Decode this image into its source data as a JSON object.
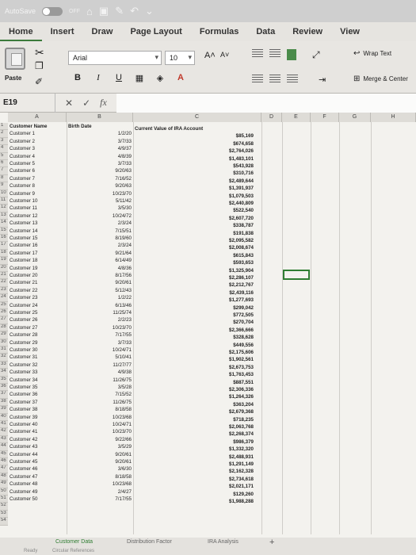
{
  "titlebar": {
    "autosave": "AutoSave",
    "toggle": "OFF"
  },
  "tabs": [
    "Home",
    "Insert",
    "Draw",
    "Page Layout",
    "Formulas",
    "Data",
    "Review",
    "View"
  ],
  "ribbon": {
    "paste_label": "Paste",
    "font_name": "Arial",
    "font_size": "10",
    "grow_font": "A˄",
    "shrink_font": "A˅",
    "bold": "B",
    "italic": "I",
    "underline": "U",
    "wrap_text": "Wrap Text",
    "merge_center": "Merge & Center"
  },
  "formula_bar": {
    "name_box": "E19",
    "fx": "fx"
  },
  "columns": [
    "A",
    "B",
    "C",
    "D",
    "E",
    "F",
    "G",
    "H"
  ],
  "headers": {
    "name": "Customer Name",
    "birth": "Birth Date",
    "value": "Current Value of IRA Account"
  },
  "rows": [
    [
      "Customer 1",
      "1/2/20",
      "$85,169"
    ],
    [
      "Customer 2",
      "3/7/33",
      "$674,658"
    ],
    [
      "Customer 3",
      "4/9/37",
      "$2,764,026"
    ],
    [
      "Customer 4",
      "4/8/39",
      "$1,483,101"
    ],
    [
      "Customer 5",
      "3/7/33",
      "$543,928"
    ],
    [
      "Customer 6",
      "9/20/63",
      "$310,716"
    ],
    [
      "Customer 7",
      "7/16/52",
      "$2,489,644"
    ],
    [
      "Customer 8",
      "9/20/63",
      "$1,391,937"
    ],
    [
      "Customer 9",
      "10/23/70",
      "$1,079,503"
    ],
    [
      "Customer 10",
      "5/11/42",
      "$2,440,809"
    ],
    [
      "Customer 11",
      "3/5/30",
      "$522,540"
    ],
    [
      "Customer 12",
      "10/24/72",
      "$2,607,720"
    ],
    [
      "Customer 13",
      "2/3/24",
      "$338,787"
    ],
    [
      "Customer 14",
      "7/15/51",
      "$191,838"
    ],
    [
      "Customer 15",
      "8/19/60",
      "$2,095,582"
    ],
    [
      "Customer 16",
      "2/3/24",
      "$2,008,674"
    ],
    [
      "Customer 17",
      "9/21/64",
      "$615,843"
    ],
    [
      "Customer 18",
      "6/14/49",
      "$593,653"
    ],
    [
      "Customer 19",
      "4/8/36",
      "$1,325,904"
    ],
    [
      "Customer 20",
      "8/17/56",
      "$2,286,107"
    ],
    [
      "Customer 21",
      "9/20/61",
      "$2,212,767"
    ],
    [
      "Customer 22",
      "5/12/43",
      "$2,439,116"
    ],
    [
      "Customer 23",
      "1/2/22",
      "$1,277,693"
    ],
    [
      "Customer 24",
      "6/13/46",
      "$299,042"
    ],
    [
      "Customer 25",
      "11/25/74",
      "$772,505"
    ],
    [
      "Customer 26",
      "2/2/23",
      "$270,704"
    ],
    [
      "Customer 27",
      "10/23/70",
      "$2,366,666"
    ],
    [
      "Customer 28",
      "7/17/55",
      "$328,628"
    ],
    [
      "Customer 29",
      "3/7/33",
      "$449,556"
    ],
    [
      "Customer 30",
      "10/24/71",
      "$2,175,606"
    ],
    [
      "Customer 31",
      "5/10/41",
      "$1,902,561"
    ],
    [
      "Customer 32",
      "11/27/77",
      "$2,673,753"
    ],
    [
      "Customer 33",
      "4/9/38",
      "$1,763,453"
    ],
    [
      "Customer 34",
      "11/26/75",
      "$887,551"
    ],
    [
      "Customer 35",
      "3/5/28",
      "$2,306,336"
    ],
    [
      "Customer 36",
      "7/15/52",
      "$1,264,326"
    ],
    [
      "Customer 37",
      "11/26/75",
      "$363,204"
    ],
    [
      "Customer 38",
      "8/18/58",
      "$2,679,368"
    ],
    [
      "Customer 39",
      "10/23/68",
      "$718,235"
    ],
    [
      "Customer 40",
      "10/24/71",
      "$2,063,768"
    ],
    [
      "Customer 41",
      "10/23/70",
      "$2,268,374"
    ],
    [
      "Customer 42",
      "9/22/66",
      "$986,379"
    ],
    [
      "Customer 43",
      "3/5/29",
      "$1,332,320"
    ],
    [
      "Customer 44",
      "9/20/61",
      "$2,488,931"
    ],
    [
      "Customer 45",
      "9/20/61",
      "$1,291,149"
    ],
    [
      "Customer 46",
      "3/6/30",
      "$2,162,328"
    ],
    [
      "Customer 47",
      "8/18/58",
      "$2,734,618"
    ],
    [
      "Customer 48",
      "10/23/68",
      "$2,021,171"
    ],
    [
      "Customer 49",
      "2/4/27",
      "$129,260"
    ],
    [
      "Customer 50",
      "7/17/55",
      "$1,988,288"
    ]
  ],
  "sheets": [
    "Customer Data",
    "Distribution Factor",
    "IRA Analysis"
  ],
  "add_sheet": "+",
  "status": {
    "ready": "Ready",
    "circular": "Circular References"
  },
  "colors": {
    "accent": "#2f7d32",
    "toolbar": "#e8e6e2"
  }
}
